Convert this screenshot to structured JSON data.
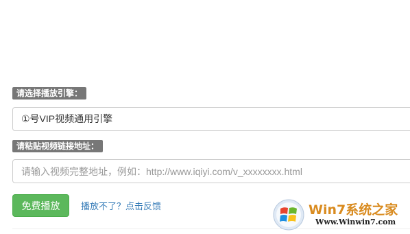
{
  "engine_section": {
    "label": "请选择播放引擎：",
    "selected_option": "①号VIP视频通用引擎"
  },
  "url_section": {
    "label": "请粘贴视频链接地址：",
    "placeholder": "请输入视频完整地址，例如：http://www.iqiyi.com/v_xxxxxxxx.html"
  },
  "actions": {
    "play_label": "免费播放",
    "feedback_label": "播放不了？点击反馈"
  },
  "watermark": {
    "brand": "Win7系统之家",
    "url": "Www.Winwin7.com",
    "icon": "windows-logo-icon"
  },
  "colors": {
    "label_bg": "#777777",
    "play_button": "#5cb85c",
    "link": "#337ab7"
  }
}
